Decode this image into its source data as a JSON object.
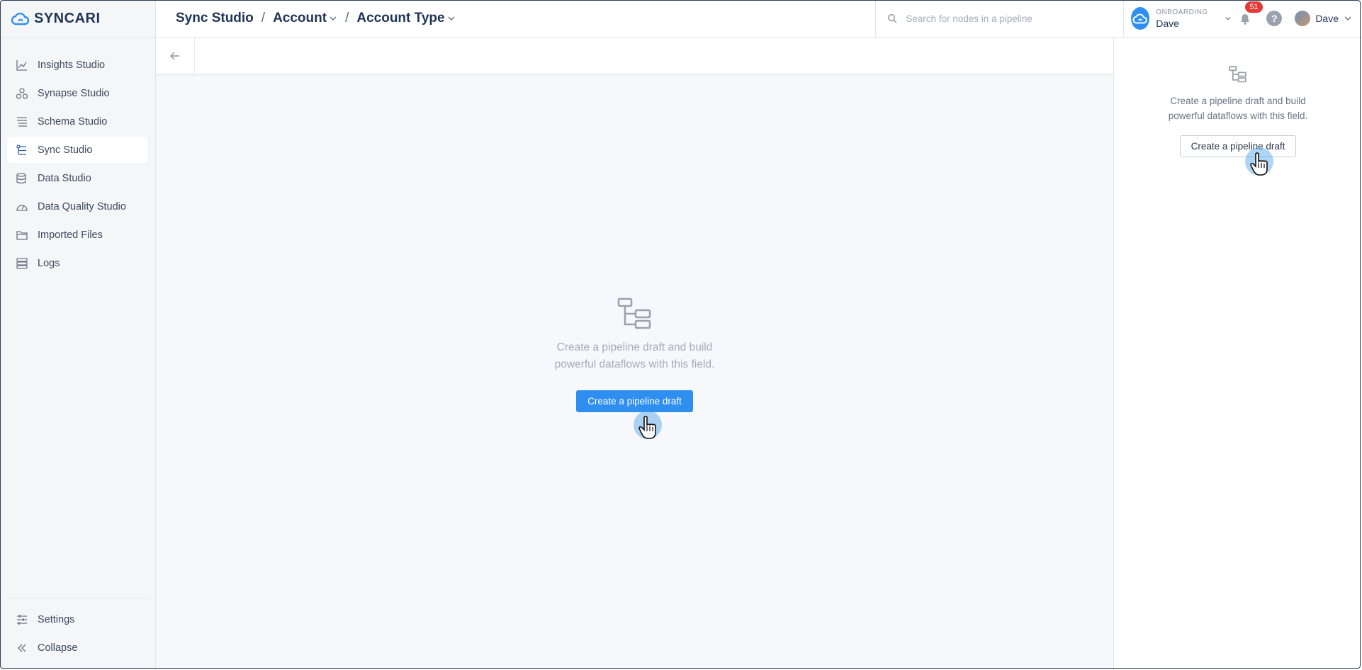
{
  "brand": {
    "name": "SYNCARI"
  },
  "sidebar": {
    "items": [
      {
        "label": "Insights Studio",
        "icon": "chart-line-icon"
      },
      {
        "label": "Synapse Studio",
        "icon": "synapse-icon"
      },
      {
        "label": "Schema Studio",
        "icon": "schema-list-icon"
      },
      {
        "label": "Sync Studio",
        "icon": "sync-flow-icon",
        "active": true
      },
      {
        "label": "Data Studio",
        "icon": "database-icon"
      },
      {
        "label": "Data Quality Studio",
        "icon": "gauge-icon"
      },
      {
        "label": "Imported Files",
        "icon": "folder-icon"
      },
      {
        "label": "Logs",
        "icon": "logs-icon"
      }
    ],
    "settings_label": "Settings",
    "collapse_label": "Collapse"
  },
  "header": {
    "breadcrumb": {
      "root": "Sync Studio",
      "entity": "Account",
      "field": "Account Type"
    },
    "search_placeholder": "Search for nodes in a pipeline",
    "workspace": {
      "label": "ONBOARDING",
      "name": "Dave"
    },
    "notifications_count": "51",
    "help_label": "?",
    "user_name": "Dave"
  },
  "main": {
    "empty_message_line1": "Create a pipeline draft and build",
    "empty_message_line2": "powerful dataflows with this field.",
    "create_button": "Create a pipeline draft"
  },
  "panel": {
    "message_line1": "Create a pipeline draft and build",
    "message_line2": "powerful dataflows with this field.",
    "create_button": "Create a pipeline draft"
  },
  "colors": {
    "primary": "#2f8ff0",
    "brand": "#1f3556",
    "badge": "#e53935"
  }
}
